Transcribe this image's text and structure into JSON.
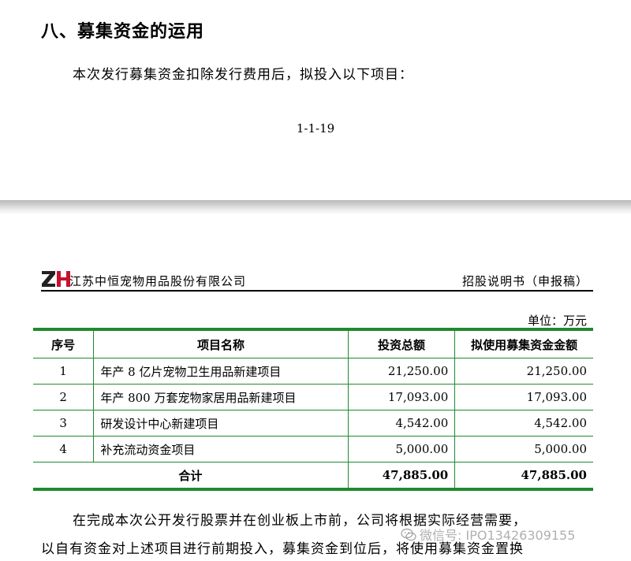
{
  "section": {
    "title": "八、募集资金的运用",
    "intro": "本次发行募集资金扣除发行费用后，拟投入以下项目：",
    "page_number": "1-1-19"
  },
  "header": {
    "company": "江苏中恒宠物用品股份有限公司",
    "doc_type": "招股说明书（申报稿）"
  },
  "table": {
    "unit": "单位：万元",
    "columns": [
      "序号",
      "项目名称",
      "投资总额",
      "拟使用募集资金金额"
    ],
    "rows": [
      [
        "1",
        "年产 8 亿片宠物卫生用品新建项目",
        "21,250.00",
        "21,250.00"
      ],
      [
        "2",
        "年产 800 万套宠物家居用品新建项目",
        "17,093.00",
        "17,093.00"
      ],
      [
        "3",
        "研发设计中心新建项目",
        "4,542.00",
        "4,542.00"
      ],
      [
        "4",
        "补充流动资金项目",
        "5,000.00",
        "5,000.00"
      ]
    ],
    "total": {
      "label": "合计",
      "investment": "47,885.00",
      "raised": "47,885.00"
    }
  },
  "body": {
    "para1": "在完成本次公开发行股票并在创业板上市前，公司将根据实际经营需要，",
    "para2": "以自有资金对上述项目进行前期投入，募集资金到位后，将使用募集资金置换"
  },
  "watermark": {
    "icon": "wechat-icon",
    "text": "微信号: IPO13426309155"
  },
  "colors": {
    "table_rule": "#1f8a2e",
    "logo_red": "#c8102e",
    "logo_dark": "#222222"
  }
}
